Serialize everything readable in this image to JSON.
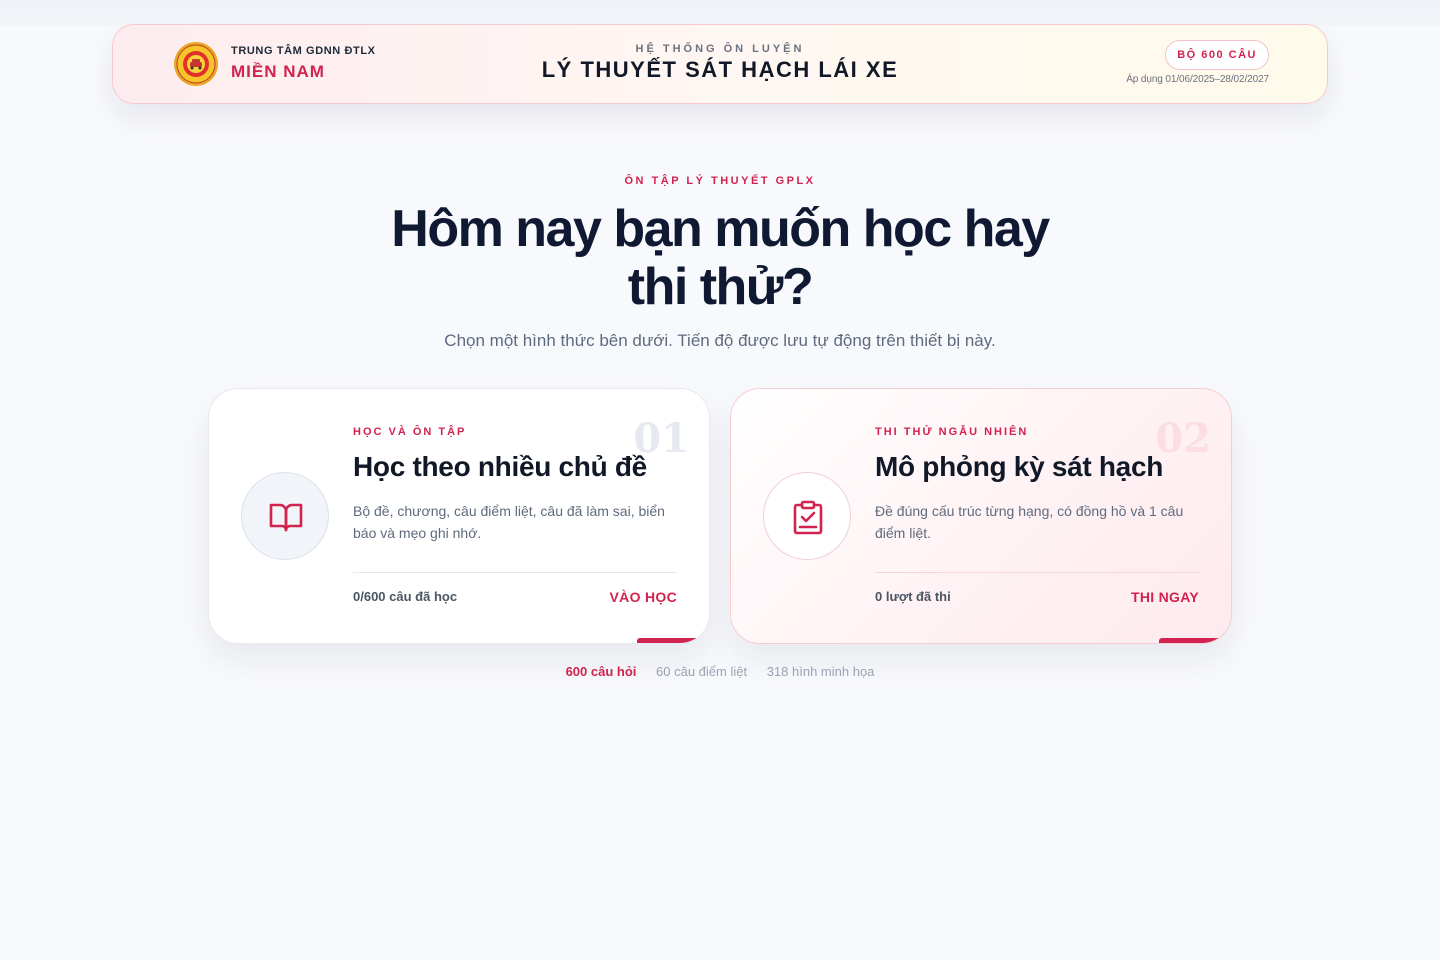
{
  "header": {
    "brand_top": "TRUNG TÂM GDNN ĐTLX",
    "brand_main": "MIỀN NAM",
    "kicker": "HỆ THỐNG ÔN LUYỆN",
    "title": "LÝ THUYẾT SÁT HẠCH LÁI XE",
    "badge": "BỘ 600 CÂU",
    "applies": "Áp dụng 01/06/2025–28/02/2027"
  },
  "hero": {
    "kicker": "ÔN TẬP LÝ THUYẾT GPLX",
    "headline": "Hôm nay bạn muốn học hay thi thử?",
    "subline": "Chọn một hình thức bên dưới. Tiến độ được lưu tự động trên thiết bị này."
  },
  "cards": [
    {
      "number": "01",
      "kicker": "HỌC VÀ ÔN TẬP",
      "title": "Học theo nhiều chủ đề",
      "description": "Bộ đề, chương, câu điểm liệt, câu đã làm sai, biển báo và mẹo ghi nhớ.",
      "stat": "0/600 câu đã học",
      "cta": "VÀO HỌC",
      "icon": "book-open-icon"
    },
    {
      "number": "02",
      "kicker": "THI THỬ NGẪU NHIÊN",
      "title": "Mô phỏng kỳ sát hạch",
      "description": "Đề đúng cấu trúc từng hạng, có đồng hồ và 1 câu điểm liệt.",
      "stat": "0 lượt đã thi",
      "cta": "THI NGAY",
      "icon": "clipboard-check-icon"
    }
  ],
  "stats": {
    "questions": "600 câu hỏi",
    "critical": "60 câu điểm liệt",
    "images": "318 hình minh họa"
  },
  "colors": {
    "accent": "#d1234f",
    "ink": "#0f1932",
    "muted": "#5f6b7d",
    "background": "#f8f9fc"
  }
}
